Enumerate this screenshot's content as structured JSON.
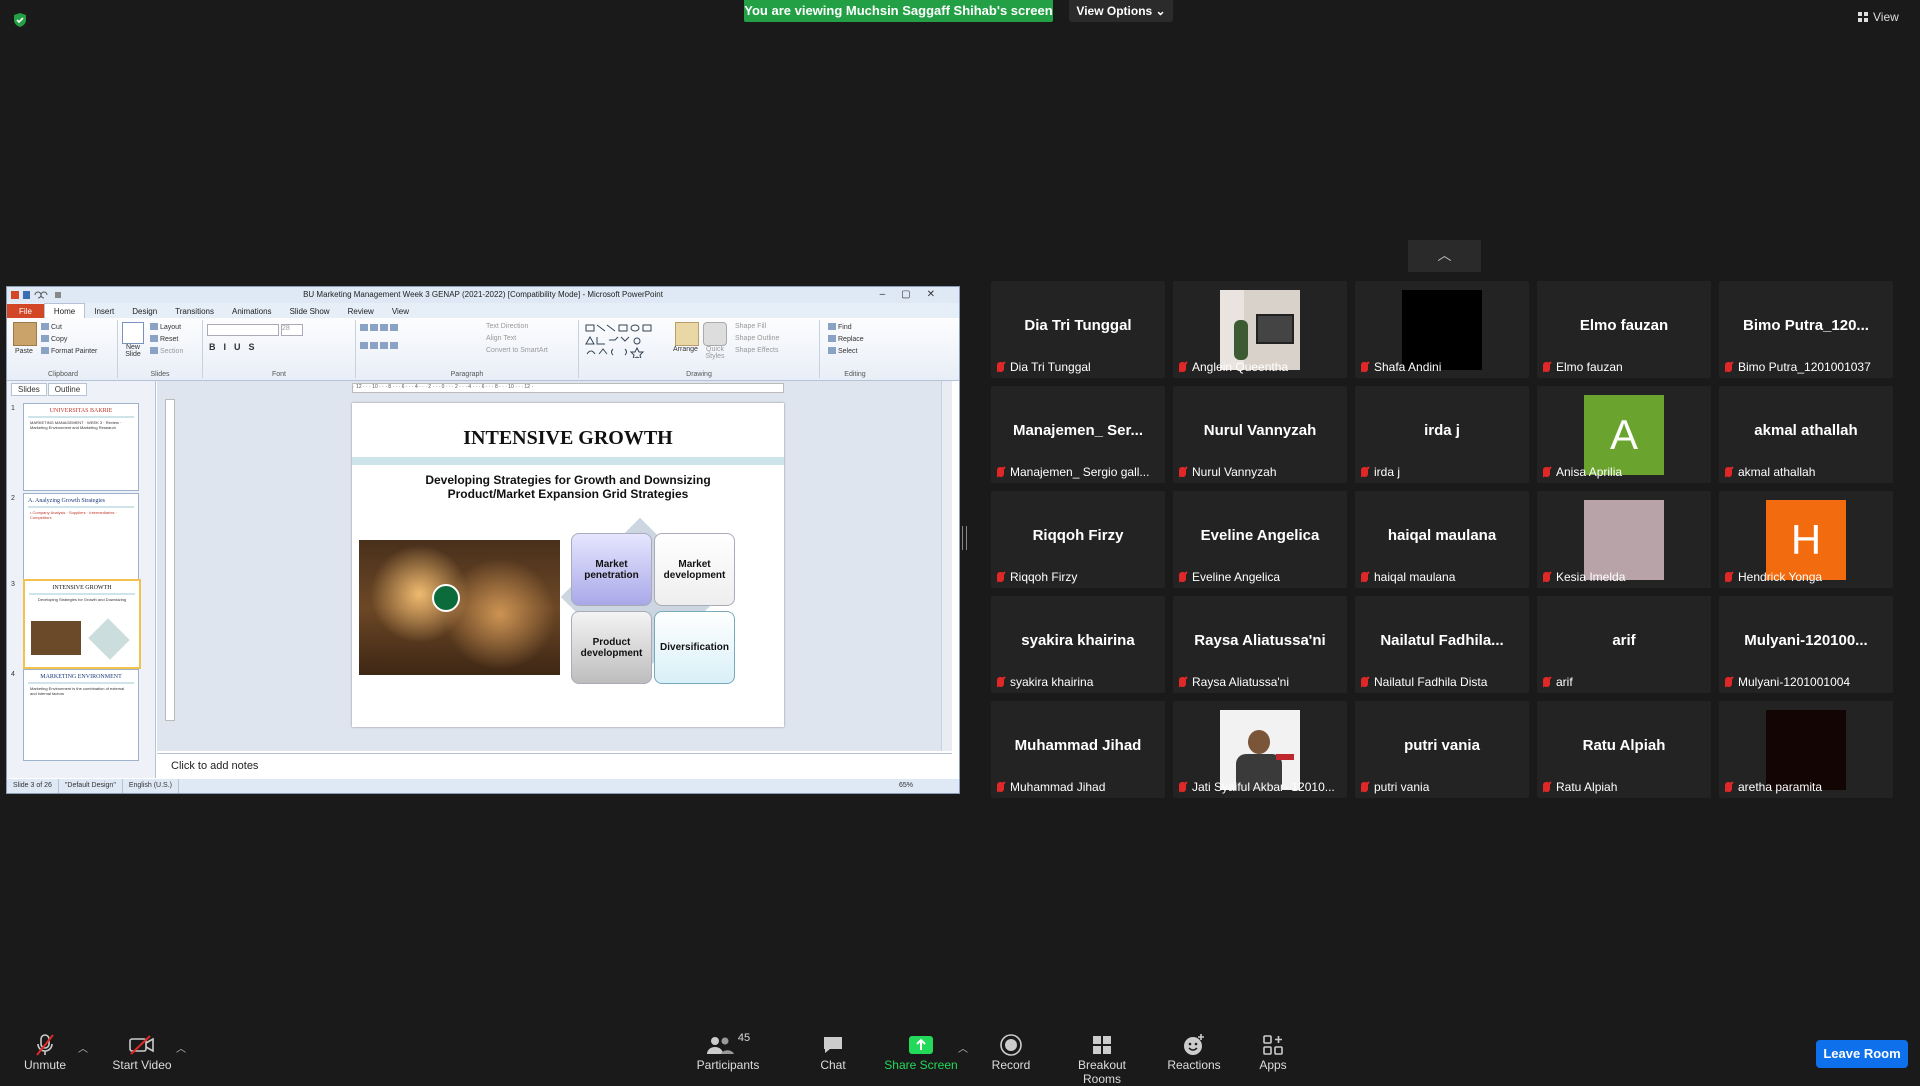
{
  "top": {
    "banner": "You are viewing Muchsin Saggaff Shihab's screen",
    "view_options": "View Options ⌄",
    "view_button": "View"
  },
  "ppt": {
    "window_title": "BU Marketing Management Week 3 GENAP (2021-2022) [Compatibility Mode] - Microsoft PowerPoint",
    "tabs": [
      "File",
      "Home",
      "Insert",
      "Design",
      "Transitions",
      "Animations",
      "Slide Show",
      "Review",
      "View"
    ],
    "ribbon": {
      "paste": "Paste",
      "cut": "Cut",
      "copy": "Copy",
      "format_painter": "Format Painter",
      "clipboard": "Clipboard",
      "new_slide": "New Slide",
      "layout": "Layout",
      "reset": "Reset",
      "section": "Section",
      "slides": "Slides",
      "font": "Font",
      "font_size": "28",
      "text_direction": "Text Direction",
      "align_text": "Align Text",
      "convert_smartart": "Convert to SmartArt",
      "paragraph": "Paragraph",
      "arrange": "Arrange",
      "quick_styles": "Quick Styles",
      "shape_fill": "Shape Fill",
      "shape_outline": "Shape Outline",
      "shape_effects": "Shape Effects",
      "drawing": "Drawing",
      "find": "Find",
      "replace": "Replace",
      "select": "Select",
      "editing": "Editing"
    },
    "pane_tabs": [
      "Slides",
      "Outline"
    ],
    "thumbs": [
      {
        "num": "1",
        "title": "UNIVERSITAS BAKRIE",
        "text": "MARKETING MANAGEMENT · WEEK 3 · Review · Marketing Environment and Marketing Research"
      },
      {
        "num": "2",
        "title": "A. Analyzing Growth Strategies",
        "text": "• Company Analysis · Suppliers · Intermediaries · Competitors"
      },
      {
        "num": "3",
        "title": "INTENSIVE GROWTH",
        "text": "Developing Strategies for Growth and Downsizing"
      },
      {
        "num": "4",
        "title": "MARKETING ENVIRONMENT",
        "text": "Marketing Environment is the combination of external and internal factors"
      }
    ],
    "slide": {
      "title": "INTENSIVE GROWTH",
      "subtitle_1": "Developing Strategies for Growth and Downsizing",
      "subtitle_2": "Product/Market Expansion Grid Strategies",
      "box_1": "Market penetration",
      "box_2": "Market development",
      "box_3": "Product development",
      "box_4": "Diversification"
    },
    "notes": "Click to add notes",
    "status": {
      "slide": "Slide 3 of 26",
      "theme": "\"Default Design\"",
      "lang": "English (U.S.)",
      "zoom": "65%"
    }
  },
  "participants": [
    {
      "big": "Dia Tri Tunggal",
      "name": "Dia Tri Tunggal"
    },
    {
      "big": "",
      "name": "Anglein Queentha",
      "avatar": "photo-room"
    },
    {
      "big": "",
      "name": "Shafa Andini",
      "avatar": "black"
    },
    {
      "big": "Elmo fauzan",
      "name": "Elmo fauzan"
    },
    {
      "big": "Bimo Putra_120...",
      "name": "Bimo Putra_1201001037"
    },
    {
      "big": "Manajemen_ Ser...",
      "name": "Manajemen_ Sergio gall..."
    },
    {
      "big": "Nurul Vannyzah",
      "name": "Nurul Vannyzah"
    },
    {
      "big": "irda j",
      "name": "irda j"
    },
    {
      "big": "",
      "name": "Anisa Aprilia",
      "avatar": "letter",
      "letter": "A",
      "color": "#6aa42f"
    },
    {
      "big": "akmal athallah",
      "name": "akmal athallah"
    },
    {
      "big": "Riqqoh Firzy",
      "name": "Riqqoh Firzy"
    },
    {
      "big": "Eveline Angelica",
      "name": "Eveline Angelica"
    },
    {
      "big": "haiqal maulana",
      "name": "haiqal maulana"
    },
    {
      "big": "",
      "name": "Kesia Imelda",
      "avatar": "pink"
    },
    {
      "big": "",
      "name": "Hendrick Yonga",
      "avatar": "letter",
      "letter": "H",
      "color": "#f26b0f"
    },
    {
      "big": "syakira khairina",
      "name": "syakira khairina"
    },
    {
      "big": "Raysa Aliatussa'ni",
      "name": "Raysa Aliatussa'ni"
    },
    {
      "big": "Nailatul  Fadhila...",
      "name": "Nailatul Fadhila Dista"
    },
    {
      "big": "arif",
      "name": "arif"
    },
    {
      "big": "Mulyani-120100...",
      "name": "Mulyani-1201001004"
    },
    {
      "big": "Muhammad Jihad",
      "name": "Muhammad Jihad"
    },
    {
      "big": "",
      "name": "Jati Syaiful Akbar- 12010...",
      "avatar": "photo-person"
    },
    {
      "big": "putri vania",
      "name": "putri vania"
    },
    {
      "big": "Ratu Alpiah",
      "name": "Ratu Alpiah"
    },
    {
      "big": "",
      "name": "aretha paramita",
      "avatar": "darkred"
    }
  ],
  "toolbar": {
    "unmute": "Unmute",
    "start_video": "Start Video",
    "participants": "Participants",
    "participants_count": "45",
    "chat": "Chat",
    "share_screen": "Share Screen",
    "record": "Record",
    "breakout_rooms": "Breakout Rooms",
    "reactions": "Reactions",
    "apps": "Apps",
    "leave": "Leave Room"
  },
  "colors": {
    "banner": "#23a046",
    "share": "#23d959",
    "leave": "#0e71eb",
    "muted": "#e02828"
  }
}
